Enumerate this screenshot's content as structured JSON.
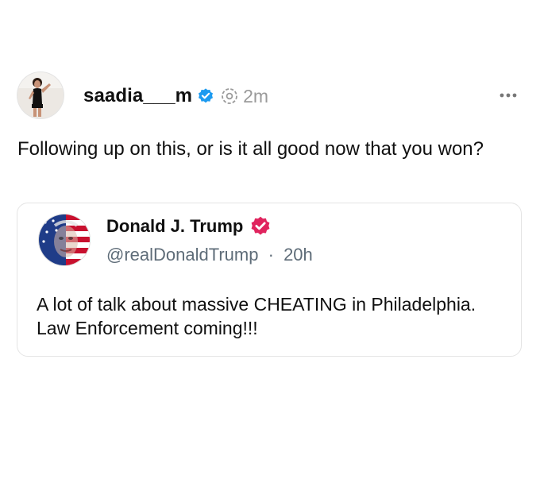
{
  "post": {
    "author": {
      "username": "saadia___m",
      "verified": true,
      "time": "2m"
    },
    "text": "Following up on this, or is it all good now that you won?",
    "more_menu_icon": "more-horizontal-icon",
    "colors": {
      "verified_badge": "#1d9bf0",
      "muted_text": "#9a9a9a"
    }
  },
  "quoted_post": {
    "author": {
      "display_name": "Donald J. Trump",
      "handle": "@realDonaldTrump",
      "separator": "·",
      "time": "20h",
      "verified": true
    },
    "text": "A lot of talk about massive CHEATING in Philadelphia. Law Enforcement coming!!!",
    "colors": {
      "verified_badge": "#e0245e"
    }
  }
}
